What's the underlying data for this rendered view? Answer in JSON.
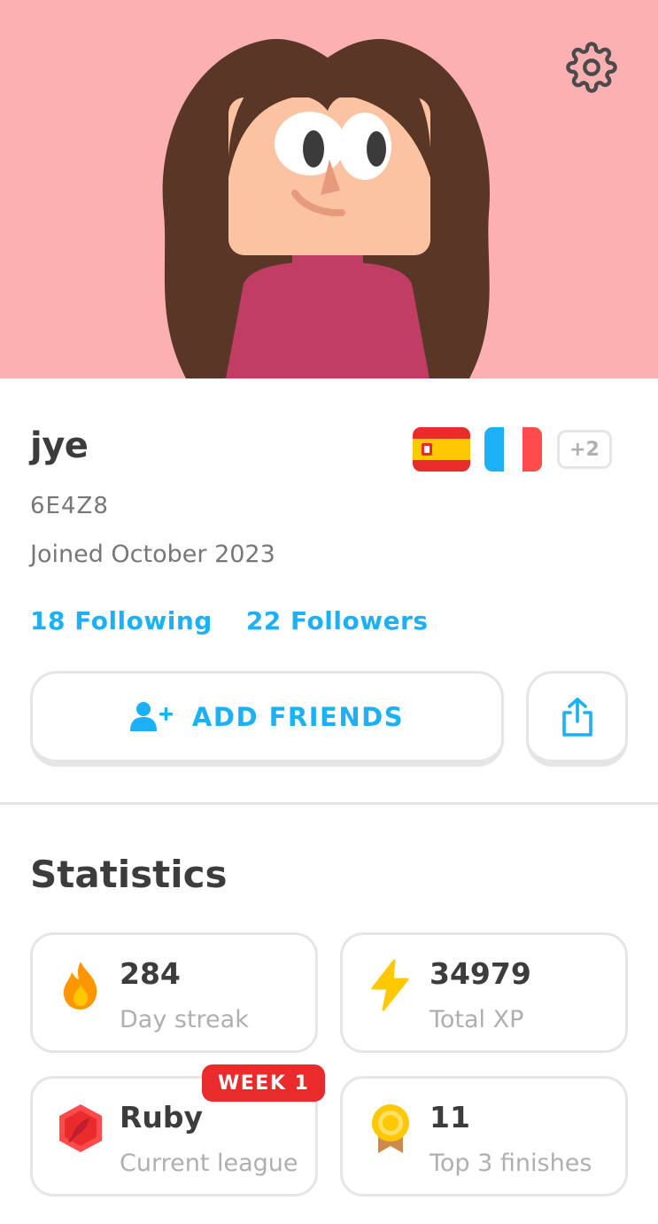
{
  "profile": {
    "username": "jye",
    "user_code": "6E4Z8",
    "joined": "Joined October 2023",
    "following": "18 Following",
    "followers": "22 Followers",
    "more_courses": "+2"
  },
  "actions": {
    "add_friends_label": "ADD FRIENDS"
  },
  "statistics": {
    "title": "Statistics",
    "cards": [
      {
        "value": "284",
        "caption": "Day streak",
        "icon": "flame-icon"
      },
      {
        "value": "34979",
        "caption": "Total XP",
        "icon": "lightning-icon"
      },
      {
        "value": "Ruby",
        "caption": "Current league",
        "icon": "ruby-league-icon",
        "badge": "WEEK 1"
      },
      {
        "value": "11",
        "caption": "Top 3 finishes",
        "icon": "medal-icon"
      }
    ]
  },
  "colors": {
    "hero_bg": "#fdb0b2",
    "link_blue": "#1cb0f6",
    "badge_red": "#ea2b2b"
  }
}
